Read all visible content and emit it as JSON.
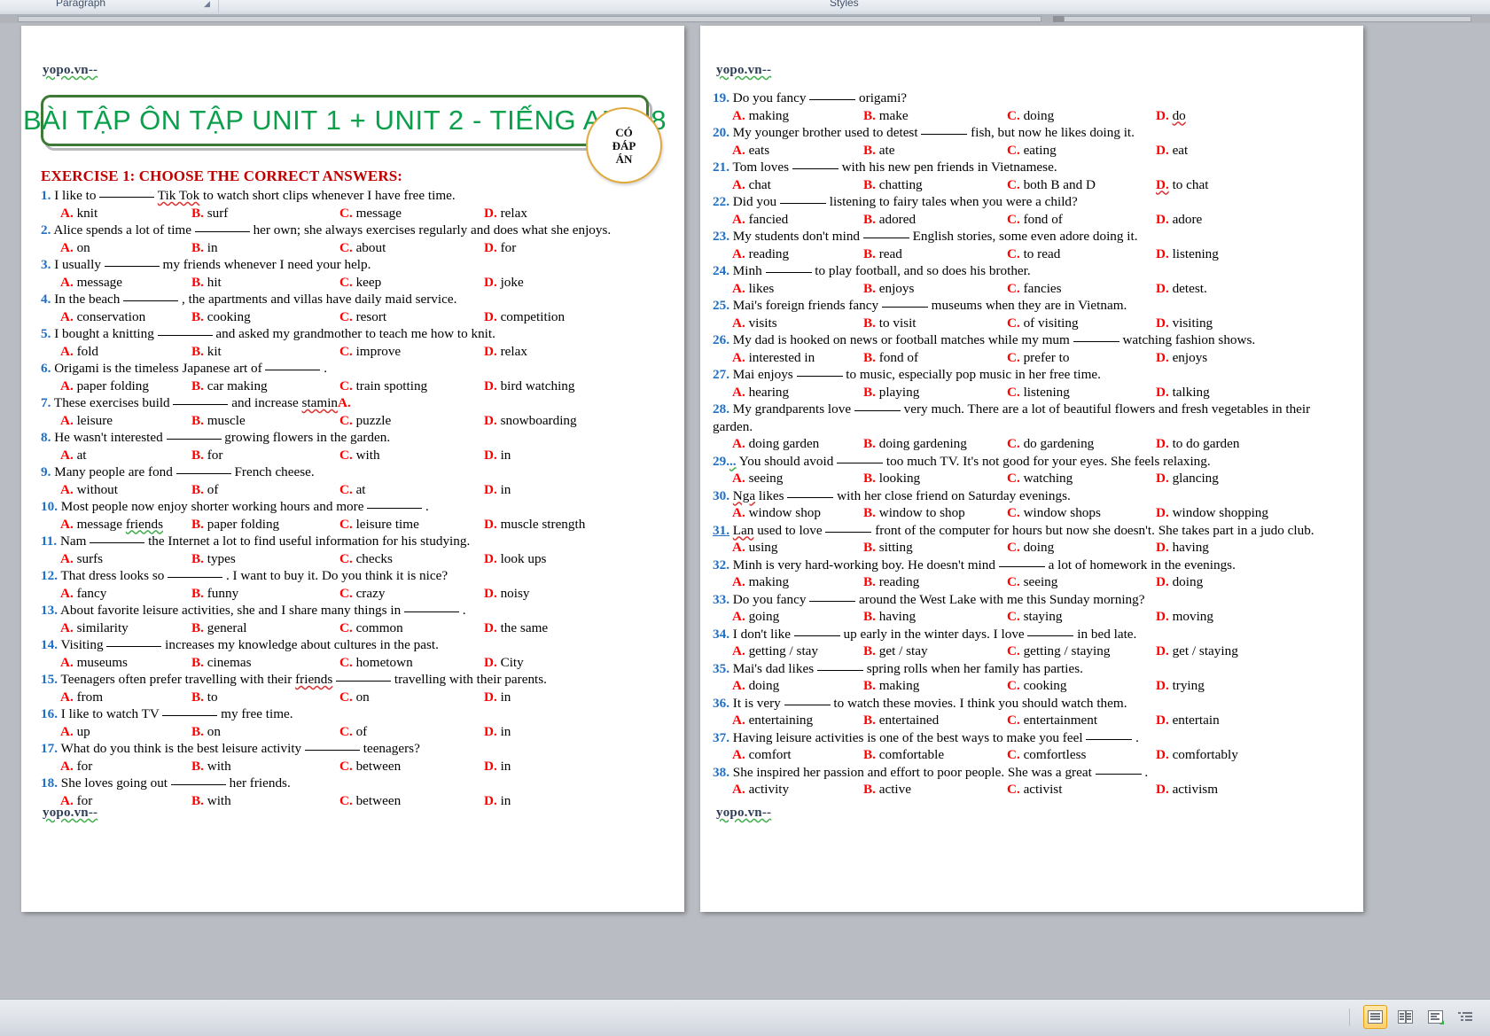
{
  "app": {
    "ribbon_groups": [
      "Paragraph",
      "Styles"
    ],
    "status_views": [
      "print-layout-view",
      "two-page-view",
      "web-layout-view",
      "outline-view"
    ]
  },
  "watermark": "yopo.vn--",
  "document": {
    "title": "BÀI TẬP ÔN TẬP UNIT 1 + UNIT 2 - TIẾNG ANH 8",
    "badge_lines": [
      "CÓ",
      "ĐÁP",
      "ÁN"
    ],
    "exercise_heading": "EXERCISE 1: CHOOSE THE CORRECT ANSWERS:",
    "questions_left": [
      {
        "num": "1.",
        "pre": "I like to ",
        "mid": "Tik Tok to watch short clips whenever I have free time.",
        "mid_squiggle": "Tik Tok",
        "options": [
          "knit",
          "surf",
          "message",
          "relax"
        ]
      },
      {
        "num": "2.",
        "pre": "Alice spends a lot of time ",
        "mid": "her own; she always exercises regularly and does what she enjoys.",
        "options": [
          "on",
          "in",
          "about",
          "for"
        ]
      },
      {
        "num": "3.",
        "pre": "I usually ",
        "mid": "my friends whenever I need your help.",
        "options": [
          "message",
          "hit",
          "keep",
          "joke"
        ]
      },
      {
        "num": "4.",
        "pre": "In the beach ",
        "mid": ", the apartments and villas have daily maid service.",
        "options": [
          "conservation",
          "cooking",
          "resort",
          "competition"
        ]
      },
      {
        "num": "5.",
        "pre": "I bought a knitting ",
        "mid": "and asked my grandmother to teach me how to knit.",
        "options": [
          "fold",
          "kit",
          "improve",
          "relax"
        ]
      },
      {
        "num": "6.",
        "pre": "Origami is the timeless Japanese art of ",
        "mid": ".",
        "options": [
          "paper folding",
          "car making",
          "train spotting",
          "bird watching"
        ]
      },
      {
        "num": "7.",
        "pre": "These exercises build ",
        "mid": "and increase stamin",
        "tail_red": "A.",
        "tail_squiggle": "stamin",
        "options": [
          "leisure",
          "muscle",
          "puzzle",
          "snowboarding"
        ]
      },
      {
        "num": "8.",
        "pre": "He wasn't interested ",
        "mid": "growing flowers in the garden.",
        "options": [
          "at",
          "for",
          "with",
          "in"
        ]
      },
      {
        "num": "9.",
        "pre": "Many people are fond ",
        "mid": "French cheese.",
        "options": [
          "without",
          "of",
          "at",
          "in"
        ]
      },
      {
        "num": "10.",
        "pre": "Most people now enjoy shorter working hours and more ",
        "mid": ".",
        "options": [
          "message friends",
          "paper folding",
          "leisure time",
          "muscle strength"
        ],
        "opt0_underline": "friends"
      },
      {
        "num": "11.",
        "pre": "Nam ",
        "mid": "the Internet a lot to find useful information for his studying.",
        "options": [
          "surfs",
          "types",
          "checks",
          "look ups"
        ]
      },
      {
        "num": "12.",
        "pre": "That dress looks so ",
        "mid": ". I want to buy it. Do you think it is nice?",
        "options": [
          "fancy",
          "funny",
          "crazy",
          "noisy"
        ]
      },
      {
        "num": "13.",
        "pre": "About favorite leisure activities, she and I share many things in ",
        "mid": ".",
        "options": [
          "similarity",
          "general",
          "common",
          "the same"
        ]
      },
      {
        "num": "14.",
        "pre": "Visiting ",
        "mid": "increases my knowledge about cultures in the past.",
        "options": [
          "museums",
          "cinemas",
          "hometown",
          "City"
        ]
      },
      {
        "num": "15.",
        "pre": "Teenagers often prefer travelling with their friends ",
        "mid": "travelling with their parents.",
        "pre_squiggle": "friends",
        "options": [
          "from",
          "to",
          "on",
          "in"
        ]
      },
      {
        "num": "16.",
        "pre": "I like to watch TV ",
        "mid": "my free time.",
        "options": [
          "up",
          "on",
          "of",
          "in"
        ]
      },
      {
        "num": "17.",
        "pre": "What do you think is the best leisure activity ",
        "mid": "teenagers?",
        "options": [
          "for",
          "with",
          "between",
          "in"
        ]
      },
      {
        "num": "18.",
        "pre": "She loves going out ",
        "mid": "her friends.",
        "options": [
          "for",
          "with",
          "between",
          "in"
        ]
      }
    ],
    "questions_right": [
      {
        "num": "19.",
        "pre": "Do you fancy ",
        "mid": "origami?",
        "options": [
          "making",
          "make",
          "doing",
          "do"
        ],
        "opt3_squiggle": true
      },
      {
        "num": "20.",
        "pre": "My younger brother used to detest ",
        "mid": "fish, but now he likes doing it.",
        "options": [
          "eats",
          "ate",
          "eating",
          "eat"
        ]
      },
      {
        "num": "21.",
        "pre": "Tom loves ",
        "mid": "with his new pen friends in Vietnamese.",
        "options": [
          "chat",
          "chatting",
          "both B and D",
          "to chat"
        ],
        "opt3_letter_squiggle": true
      },
      {
        "num": "22.",
        "pre": "Did you ",
        "mid": "listening to fairy tales when you were a child?",
        "options": [
          "fancied",
          "adored",
          "fond of",
          "adore"
        ]
      },
      {
        "num": "23.",
        "pre": "My students don't mind ",
        "mid": "English stories, some even adore doing it.",
        "options": [
          "reading",
          "read",
          "to read",
          "listening"
        ]
      },
      {
        "num": "24.",
        "pre": "Minh ",
        "mid": "to play football, and so does his brother.",
        "options": [
          "likes",
          "enjoys",
          "fancies",
          "detest."
        ]
      },
      {
        "num": "25.",
        "pre": "Mai's foreign friends fancy ",
        "mid": "museums when they are in Vietnam.",
        "options": [
          "visits",
          "to visit",
          "of visiting",
          "visiting"
        ]
      },
      {
        "num": "26.",
        "pre": "My dad is hooked on news or football matches while my mum ",
        "mid": "watching fashion shows.",
        "options": [
          "interested in",
          "fond of",
          "prefer to",
          "enjoys"
        ]
      },
      {
        "num": "27.",
        "pre": "Mai enjoys ",
        "mid": "to music, especially pop music in her free time.",
        "options": [
          "hearing",
          "playing",
          "listening",
          "talking"
        ]
      },
      {
        "num": "28.",
        "pre": "My grandparents love ",
        "mid": "very much. There are a lot of beautiful    flowers and fresh vegetables in their",
        "cont": "garden.",
        "options": [
          "doing garden",
          "doing gardening",
          "do gardening",
          "to do garden"
        ]
      },
      {
        "num": "29.",
        "numsuffix": "..",
        "pre": " You should avoid ",
        "mid": "too much TV. It's not good for your eyes. She feels relaxing.",
        "options": [
          "seeing",
          "looking",
          "watching",
          "glancing"
        ]
      },
      {
        "num": "30.",
        "pre": "Nga likes ",
        "mid": "with her close friend on Saturday evenings.",
        "pre_squiggle": "Nga",
        "options": [
          "window shop",
          "window to shop",
          "window shops",
          "window shopping"
        ]
      },
      {
        "num": "31.",
        "num_underline": true,
        "pre": "Lan used to love ",
        "mid": "front of the computer for hours but now she doesn't. She takes part in a judo club.",
        "pre_squiggle": "Lan",
        "options": [
          "using",
          "sitting",
          "doing",
          "having"
        ]
      },
      {
        "num": "32.",
        "pre": "Minh is very hard-working boy. He doesn't mind ",
        "mid": "a lot of homework in the evenings.",
        "options": [
          "making",
          "reading",
          "seeing",
          "doing"
        ]
      },
      {
        "num": "33.",
        "pre": "Do you fancy ",
        "mid": "around the West Lake with me this Sunday morning?",
        "options": [
          "going",
          "having",
          "staying",
          "moving"
        ]
      },
      {
        "num": "34.",
        "pre": "I don't like ",
        "mid": "up early in the winter days. I love ",
        "mid2": "in bed late.",
        "options": [
          "getting / stay",
          "get / stay",
          "getting / staying",
          "get / staying"
        ]
      },
      {
        "num": "35.",
        "pre": "Mai's dad likes ",
        "mid": "spring rolls when her family has parties.",
        "options": [
          "doing",
          "making",
          "cooking",
          "trying"
        ]
      },
      {
        "num": "36.",
        "pre": "It is very ",
        "mid": "to watch these movies. I think you should watch them.",
        "options": [
          "entertaining",
          "entertained",
          "entertainment",
          "entertain"
        ]
      },
      {
        "num": "37.",
        "pre": "Having leisure activities is one of the best ways to make you feel ",
        "mid": ".",
        "options": [
          "comfort",
          "comfortable",
          "comfortless",
          "comfortably"
        ]
      },
      {
        "num": "38.",
        "pre": "She inspired her passion and effort to poor people. She was a great ",
        "mid": ".",
        "options": [
          "activity",
          "active",
          "activist",
          "activism"
        ]
      }
    ],
    "option_letters": [
      "A.",
      "B.",
      "C.",
      "D."
    ]
  },
  "colors": {
    "title_green": "#0aa04b",
    "banner_border": "#3e7a36",
    "heading_red": "#c00000",
    "option_red": "#ff0000",
    "number_blue": "#1f6fc4",
    "badge_border": "#e0a93b"
  }
}
